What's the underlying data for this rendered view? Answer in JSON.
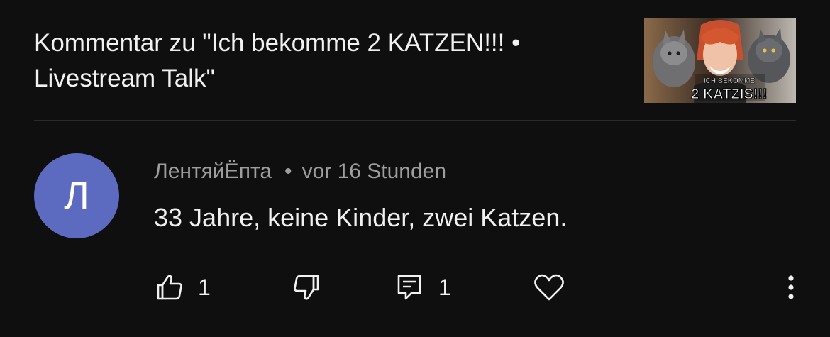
{
  "video": {
    "title": "Kommentar zu \"Ich bekomme 2 KATZEN!!! • Livestream Talk\"",
    "thumbnail_caption_line1": "ICH BEKOMME",
    "thumbnail_caption_line2": "2 KATZIS!!!"
  },
  "comment": {
    "avatar_letter": "Л",
    "author": "ЛентяйЁпта",
    "separator": "•",
    "time": "vor 16 Stunden",
    "text": "33 Jahre, keine Kinder, zwei Katzen.",
    "like_count": "1",
    "reply_count": "1"
  },
  "colors": {
    "background": "#0f0f0f",
    "avatar": "#5c6bc0",
    "meta_text": "#9e9e9e",
    "primary_text": "#f1f1f1"
  },
  "icons": {
    "like": "thumbs-up-icon",
    "dislike": "thumbs-down-icon",
    "reply": "reply-comment-icon",
    "heart": "heart-icon",
    "more": "more-vertical-icon"
  }
}
